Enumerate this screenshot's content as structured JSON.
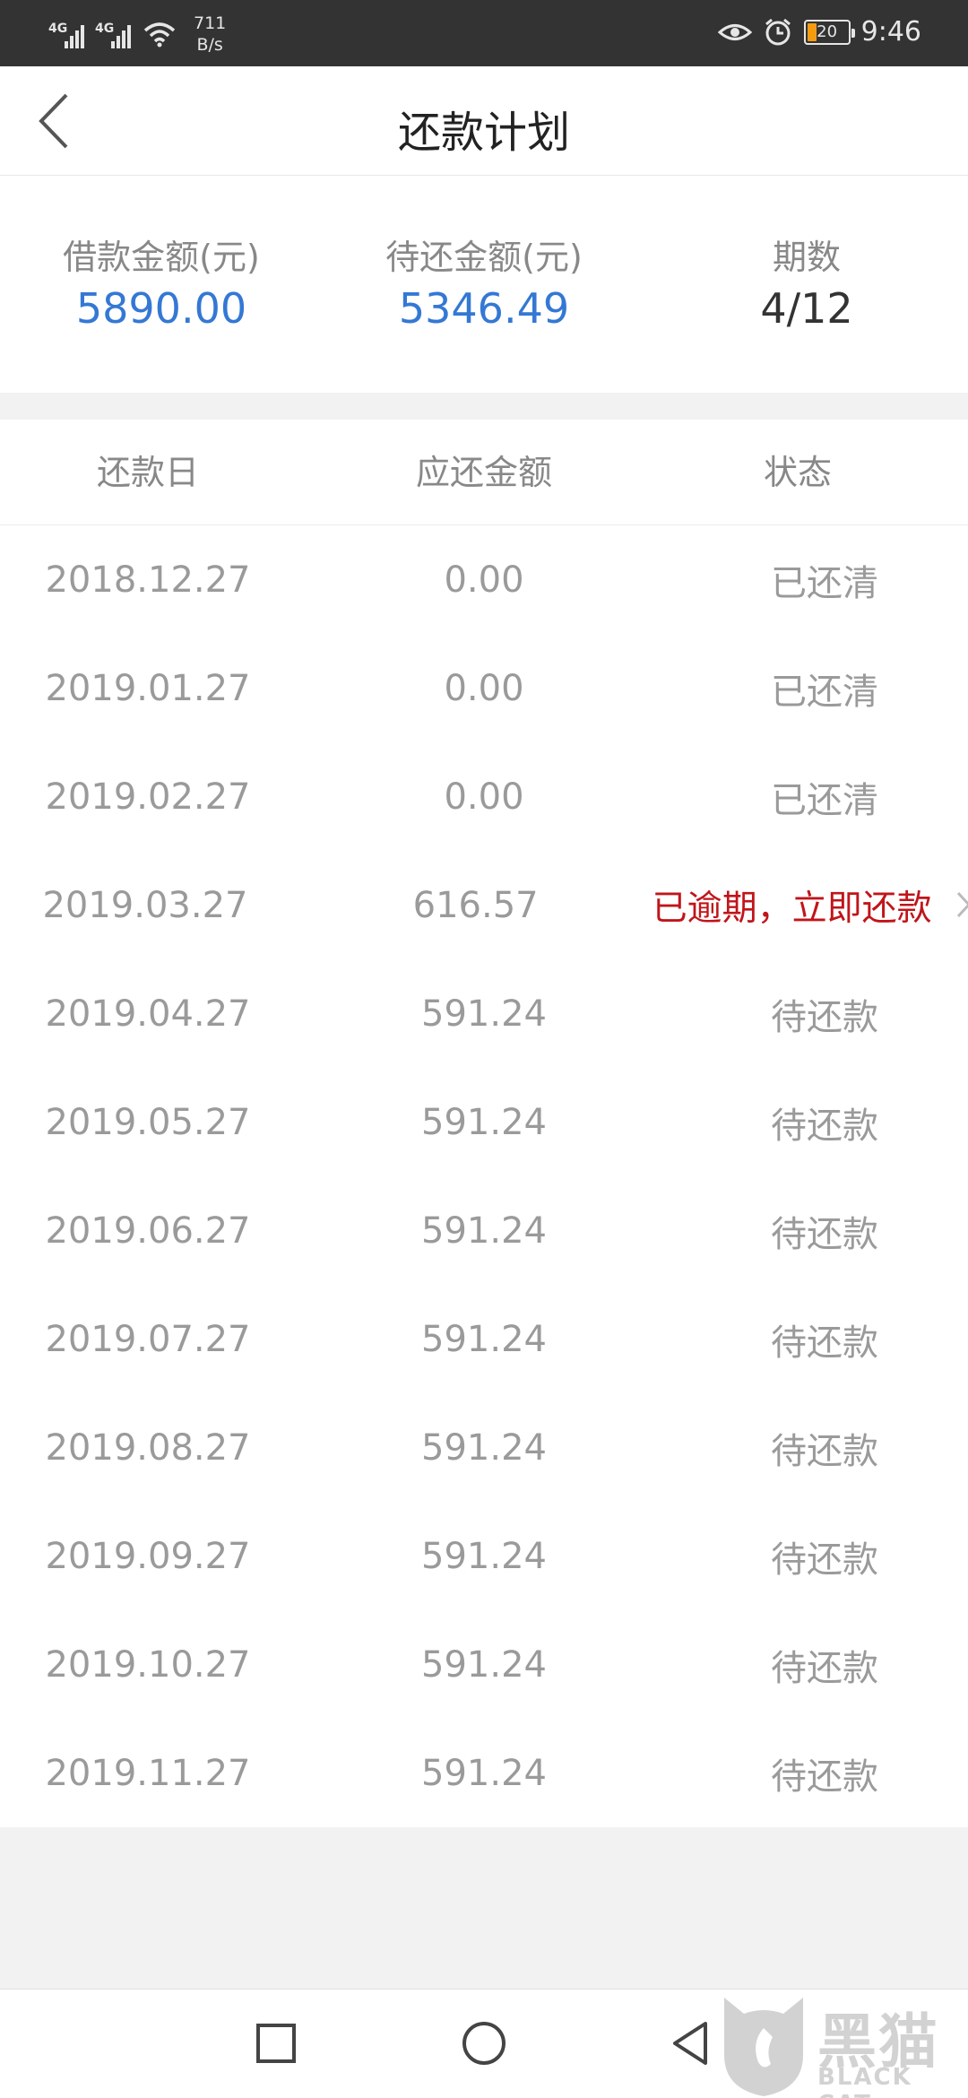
{
  "status_bar": {
    "signal1_label": "4G",
    "signal2_label": "4G",
    "speed_value": "711",
    "speed_unit": "B/s",
    "battery": "20",
    "time": "9:46",
    "icons": [
      "eye-icon",
      "alarm-icon",
      "battery-icon"
    ],
    "battery_color": "#f39c12"
  },
  "header": {
    "title": "还款计划",
    "back_icon": "chevron-left-icon"
  },
  "summary": [
    {
      "label": "借款金额(元)",
      "value": "5890.00"
    },
    {
      "label": "待还金额(元)",
      "value": "5346.49"
    },
    {
      "label": "期数",
      "value": "4/12"
    }
  ],
  "table": {
    "headers": [
      "还款日",
      "应还金额",
      "状态"
    ],
    "rows": [
      {
        "date": "2018.12.27",
        "amount": "0.00",
        "status": "已还清"
      },
      {
        "date": "2019.01.27",
        "amount": "0.00",
        "status": "已还清"
      },
      {
        "date": "2019.02.27",
        "amount": "0.00",
        "status": "已还清"
      },
      {
        "date": "2019.03.27",
        "amount": "616.57",
        "status": "已逾期，立即还款"
      },
      {
        "date": "2019.04.27",
        "amount": "591.24",
        "status": "待还款"
      },
      {
        "date": "2019.05.27",
        "amount": "591.24",
        "status": "待还款"
      },
      {
        "date": "2019.06.27",
        "amount": "591.24",
        "status": "待还款"
      },
      {
        "date": "2019.07.27",
        "amount": "591.24",
        "status": "待还款"
      },
      {
        "date": "2019.08.27",
        "amount": "591.24",
        "status": "待还款"
      },
      {
        "date": "2019.09.27",
        "amount": "591.24",
        "status": "待还款"
      },
      {
        "date": "2019.10.27",
        "amount": "591.24",
        "status": "待还款"
      },
      {
        "date": "2019.11.27",
        "amount": "591.24",
        "status": "待还款"
      }
    ]
  },
  "colors": {
    "accent_blue": "#3478d4",
    "overdue_red": "#c0151a"
  },
  "nav_bar": [
    "recents-square-icon",
    "home-circle-icon",
    "back-triangle-icon"
  ],
  "watermark": {
    "text": "黑猫",
    "sub": "BLACK CAT"
  }
}
